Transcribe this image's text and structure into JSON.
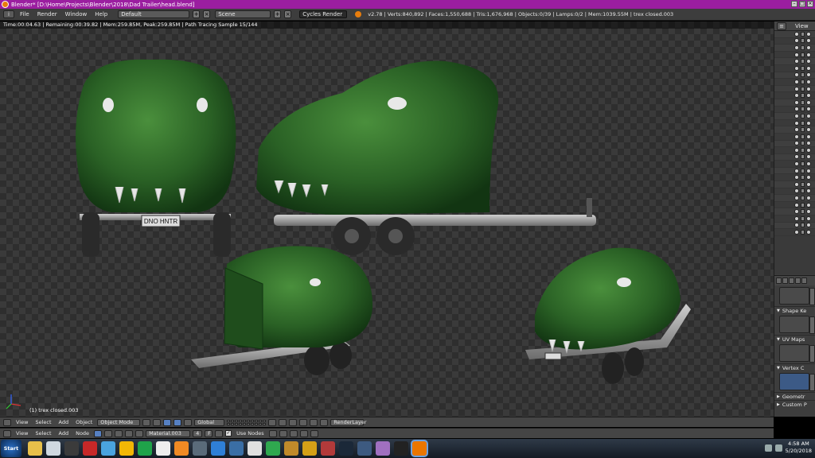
{
  "window": {
    "title": "Blender* [D:\\Home\\Projects\\Blender\\2018\\Dad Trailer\\head.blend]"
  },
  "info_header": {
    "menus": [
      "File",
      "Render",
      "Window",
      "Help"
    ],
    "layout": "Default",
    "scene": "Scene",
    "render_engine": "Cycles Render",
    "stats": "v2.78 | Verts:840,892 | Faces:1,550,688 | Tris:1,676,968 | Objects:0/39 | Lamps:0/2 | Mem:1039.55M | trex closed.003"
  },
  "viewport": {
    "render_status": "Time:00:04.63 | Remaining:00:39.82 | Mem:259.85M, Peak:259.85M | Path Tracing Sample 15/144",
    "object_label": "(1) trex closed.003",
    "plate_text": "DNO HNTR"
  },
  "view3d_header": {
    "menus": [
      "View",
      "Select",
      "Add",
      "Object"
    ],
    "mode": "Object Mode",
    "orientation": "Global",
    "render_layer": "RenderLayer"
  },
  "node_header": {
    "menus": [
      "View",
      "Select",
      "Add",
      "Node"
    ],
    "material": "Material.003",
    "users": "4",
    "fake_user": "F",
    "use_nodes_label": "Use Nodes"
  },
  "outliner": {
    "view_label": "View",
    "row_count": 30
  },
  "properties": {
    "panels": [
      "Shape Ke",
      "UV Maps",
      "Vertex C",
      "Geometr",
      "Custom P"
    ]
  },
  "taskbar": {
    "start_label": "Start",
    "time": "4:58 AM",
    "date": "5/20/2018",
    "apps": [
      {
        "name": "explorer-icon",
        "color": "#e8c04a"
      },
      {
        "name": "document-icon",
        "color": "#cfd8e0"
      },
      {
        "name": "media-icon",
        "color": "#3b3b3b"
      },
      {
        "name": "pdf-icon",
        "color": "#c62828"
      },
      {
        "name": "torrent-icon",
        "color": "#4aa3df"
      },
      {
        "name": "chrome-icon",
        "color": "#f2b705"
      },
      {
        "name": "kodi-icon",
        "color": "#1fa34a"
      },
      {
        "name": "7zip-icon",
        "color": "#eeeeee"
      },
      {
        "name": "vlc-icon",
        "color": "#f08a24"
      },
      {
        "name": "app-icon",
        "color": "#5a6b7a"
      },
      {
        "name": "arrow-icon",
        "color": "#2f7fd6"
      },
      {
        "name": "paint-icon",
        "color": "#3a6ea5"
      },
      {
        "name": "player-icon",
        "color": "#e0e0e0"
      },
      {
        "name": "settings-icon",
        "color": "#2fa84f"
      },
      {
        "name": "lion-icon",
        "color": "#c08a2a"
      },
      {
        "name": "bug-icon",
        "color": "#d4a017"
      },
      {
        "name": "game-icon",
        "color": "#b23a3a"
      },
      {
        "name": "steam-icon",
        "color": "#1b2838"
      },
      {
        "name": "waves-icon",
        "color": "#3d5a80"
      },
      {
        "name": "film-icon",
        "color": "#a070c0"
      },
      {
        "name": "alien-icon",
        "color": "#222222"
      },
      {
        "name": "blender-icon",
        "color": "#ea7600"
      }
    ]
  },
  "colors": {
    "titlebar": "#9b1ea0",
    "header": "#3d3d3d",
    "accent": "#5680c2",
    "dino_green": "#2f6b2a"
  }
}
